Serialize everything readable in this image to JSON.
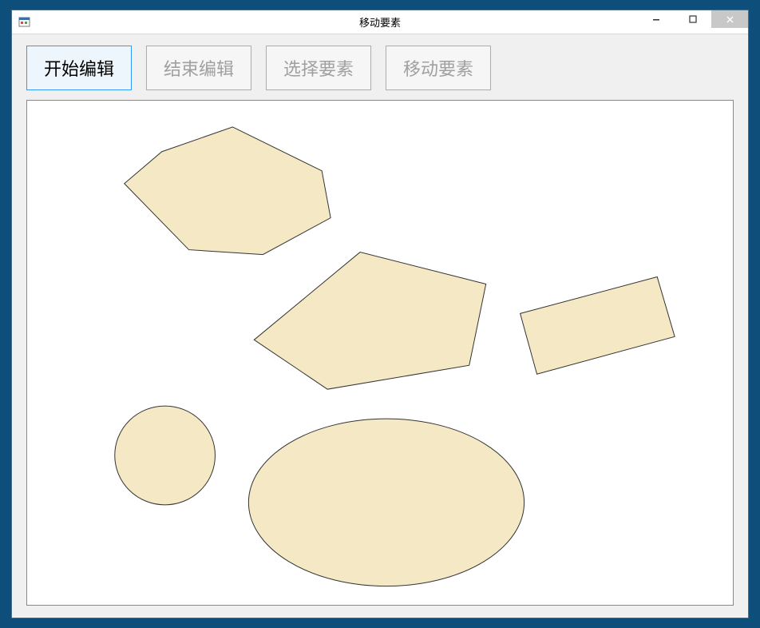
{
  "window": {
    "title": "移动要素"
  },
  "toolbar": {
    "buttons": [
      {
        "label": "开始编辑",
        "state": "active"
      },
      {
        "label": "结束编辑",
        "state": "disabled"
      },
      {
        "label": "选择要素",
        "state": "disabled"
      },
      {
        "label": "移动要素",
        "state": "disabled"
      }
    ]
  },
  "canvas": {
    "fill_color": "#f5e8c4",
    "stroke_color": "#333333",
    "shapes": [
      {
        "type": "polygon",
        "name": "polygon-heptagon"
      },
      {
        "type": "polygon",
        "name": "polygon-pentagon"
      },
      {
        "type": "polygon",
        "name": "polygon-rectangle"
      },
      {
        "type": "ellipse",
        "name": "circle-small"
      },
      {
        "type": "ellipse",
        "name": "ellipse-large"
      }
    ]
  }
}
